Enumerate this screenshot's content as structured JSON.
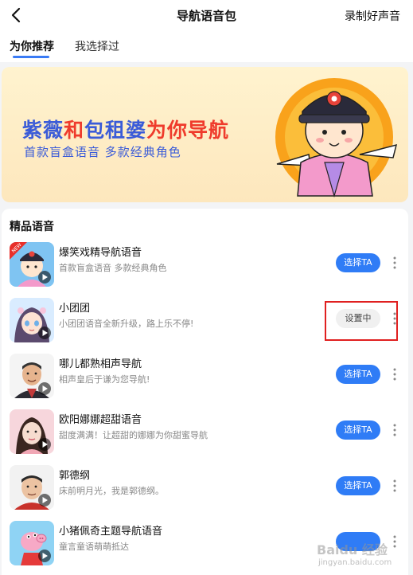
{
  "header": {
    "title": "导航语音包",
    "back_icon": "chevron-left-icon",
    "record_label": "录制好声音"
  },
  "tabs": [
    {
      "label": "为你推荐",
      "active": true
    },
    {
      "label": "我选择过",
      "active": false
    }
  ],
  "banner": {
    "headline_part1": "紫薇",
    "headline_part2": "和",
    "headline_part3": "包租婆",
    "headline_part4": "为你导航",
    "subtitle": "首款盲盒语音 多款经典角色"
  },
  "section": {
    "title": "精品语音"
  },
  "voices": [
    {
      "title": "爆笑戏精导航语音",
      "desc": "首款盲盒语音 多款经典角色",
      "action": "选择TA",
      "badge": "NEW",
      "state": "select"
    },
    {
      "title": "小团团",
      "desc": "小团团语音全新升级，路上乐不停!",
      "action": "设置中",
      "state": "setting"
    },
    {
      "title": "哪儿都熟相声导航",
      "desc": "相声皇后于谦为您导航!",
      "action": "选择TA",
      "state": "select"
    },
    {
      "title": "欧阳娜娜超甜语音",
      "desc": "甜度满满！让超甜的娜娜为你甜蜜导航",
      "action": "选择TA",
      "state": "select"
    },
    {
      "title": "郭德纲",
      "desc": "床前明月光，我是郭德纲。",
      "action": "选择TA",
      "state": "select"
    },
    {
      "title": "小猪佩奇主题导航语音",
      "desc": "童言童语萌萌抵达",
      "action": "",
      "state": "select"
    }
  ],
  "watermark": {
    "text": "Baidu 经验",
    "url": "jingyan.baidu.com"
  },
  "colors": {
    "accent": "#2f7cf6",
    "highlight": "#e02020",
    "banner_blue": "#3a5bd8",
    "banner_red": "#ef3b2c"
  }
}
